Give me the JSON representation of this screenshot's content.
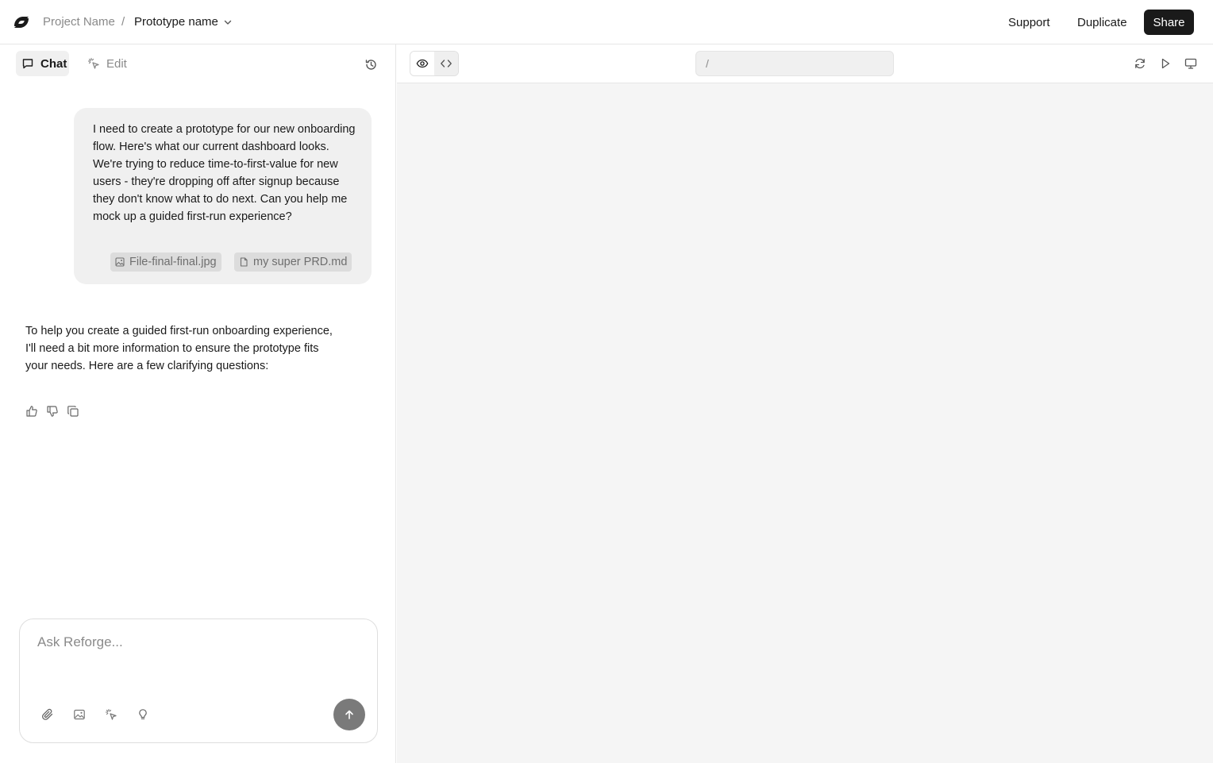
{
  "header": {
    "project_name": "Project Name",
    "separator": "/",
    "prototype_name": "Prototype name",
    "support_label": "Support",
    "duplicate_label": "Duplicate",
    "share_label": "Share"
  },
  "sidebar": {
    "tabs": [
      {
        "label": "Chat",
        "active": true
      },
      {
        "label": "Edit",
        "active": false
      }
    ]
  },
  "chat": {
    "user_message": "I need to create a prototype for our new onboarding flow. Here's what our current dashboard looks. We're trying to reduce time-to-first-value for new users - they're dropping off after signup because they don't know what to do next. Can you help me mock up a guided first-run experience?",
    "attachments": [
      {
        "name": "File-final-final.jpg",
        "icon": "image-icon"
      },
      {
        "name": "my super PRD.md",
        "icon": "file-icon"
      }
    ],
    "assistant_message": "To help you create a guided first-run onboarding experience, I'll need a bit more information to ensure the prototype fits your needs. Here are a few clarifying questions:"
  },
  "composer": {
    "placeholder": "Ask Reforge...",
    "value": ""
  },
  "preview": {
    "url_value": "/"
  },
  "colors": {
    "share_bg": "#1a1a1a",
    "send_bg": "#7a7a7a",
    "preview_bg": "#f5f5f5",
    "bubble_bg": "#f0f0f0"
  }
}
